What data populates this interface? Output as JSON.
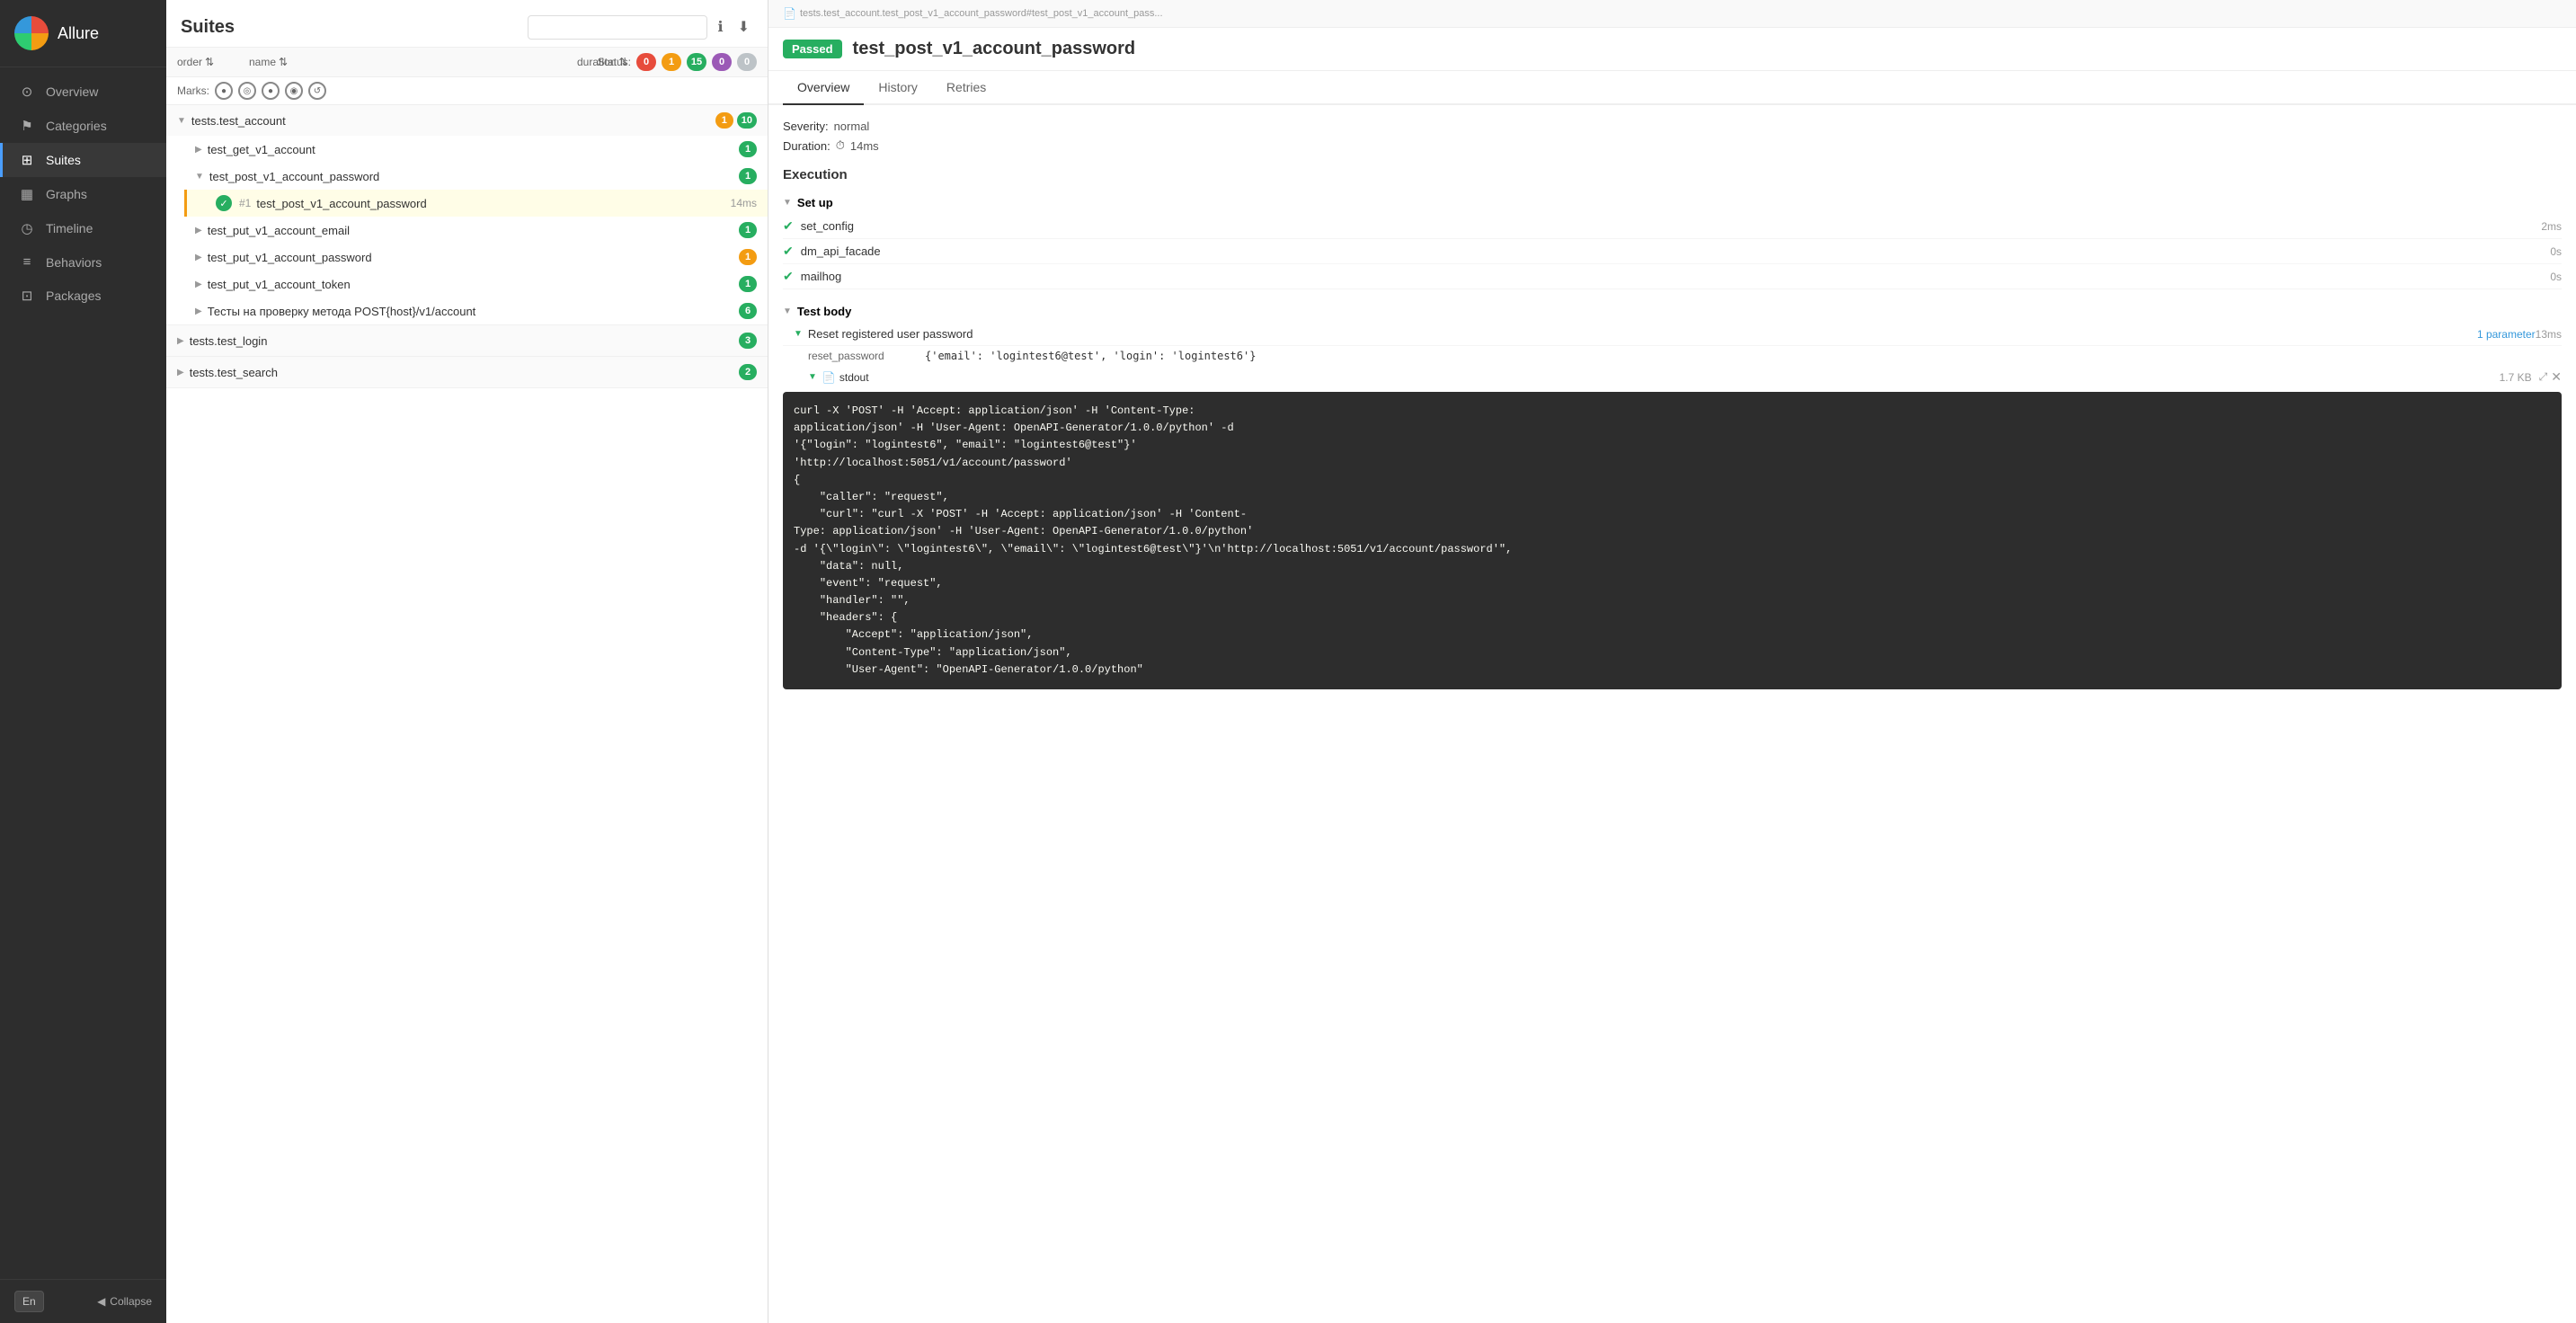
{
  "sidebar": {
    "app_name": "Allure",
    "items": [
      {
        "id": "overview",
        "label": "Overview",
        "icon": "⊙",
        "active": false
      },
      {
        "id": "categories",
        "label": "Categories",
        "icon": "⚑",
        "active": false
      },
      {
        "id": "suites",
        "label": "Suites",
        "icon": "⊞",
        "active": true
      },
      {
        "id": "graphs",
        "label": "Graphs",
        "icon": "▦",
        "active": false
      },
      {
        "id": "timeline",
        "label": "Timeline",
        "icon": "◷",
        "active": false
      },
      {
        "id": "behaviors",
        "label": "Behaviors",
        "icon": "≡",
        "active": false
      },
      {
        "id": "packages",
        "label": "Packages",
        "icon": "⊡",
        "active": false
      }
    ],
    "lang_button": "En",
    "collapse_label": "Collapse"
  },
  "suites_panel": {
    "title": "Suites",
    "search_placeholder": "",
    "columns": {
      "order": "order",
      "name": "name",
      "duration": "duration",
      "status": "status"
    },
    "status_label": "Status:",
    "status_counts": {
      "red": "0",
      "yellow": "1",
      "green": "15",
      "purple": "0",
      "gray": "0"
    },
    "marks_label": "Marks:",
    "groups": [
      {
        "id": "test_account",
        "name": "tests.test_account",
        "badge1": "1",
        "badge2": "10",
        "expanded": true,
        "children": [
          {
            "id": "test_get_v1_account",
            "name": "test_get_v1_account",
            "badge": "1",
            "expanded": false,
            "tests": []
          },
          {
            "id": "test_post_v1_account_password",
            "name": "test_post_v1_account_password",
            "badge": "1",
            "expanded": true,
            "tests": [
              {
                "id": "test1",
                "number": "#1",
                "name": "test_post_v1_account_password",
                "duration": "14ms",
                "status": "passed",
                "selected": true
              }
            ]
          },
          {
            "id": "test_put_v1_account_email",
            "name": "test_put_v1_account_email",
            "badge": "1",
            "expanded": false
          },
          {
            "id": "test_put_v1_account_password",
            "name": "test_put_v1_account_password",
            "badge": "1",
            "expanded": false
          },
          {
            "id": "test_put_v1_account_token",
            "name": "test_put_v1_account_token",
            "badge": "1",
            "expanded": false
          },
          {
            "id": "test_post_host_v1_account",
            "name": "Тесты на проверку метода POST{host}/v1/account",
            "badge": "6",
            "expanded": false
          }
        ]
      },
      {
        "id": "test_login",
        "name": "tests.test_login",
        "badge": "3",
        "expanded": false
      },
      {
        "id": "test_search",
        "name": "tests.test_search",
        "badge": "2",
        "expanded": false
      }
    ]
  },
  "detail_panel": {
    "breadcrumb": "tests.test_account.test_post_v1_account_password#test_post_v1_account_pass...",
    "breadcrumb_icon": "📄",
    "status_badge": "Passed",
    "test_name": "test_post_v1_account_password",
    "tabs": [
      "Overview",
      "History",
      "Retries"
    ],
    "active_tab": "Overview",
    "severity_label": "Severity:",
    "severity_value": "normal",
    "duration_label": "Duration:",
    "duration_value": "14ms",
    "execution_title": "Execution",
    "setup_title": "Set up",
    "setup_items": [
      {
        "name": "set_config",
        "duration": "2ms",
        "status": "passed"
      },
      {
        "name": "dm_api_facade",
        "duration": "0s",
        "status": "passed"
      },
      {
        "name": "mailhog",
        "duration": "0s",
        "status": "passed"
      }
    ],
    "test_body_title": "Test body",
    "steps": [
      {
        "name": "Reset registered user password",
        "param_count": "1 parameter",
        "duration": "13ms",
        "expanded": true,
        "params": [
          {
            "name": "reset_password",
            "value": "{'email': 'logintest6@test', 'login': 'logintest6'}"
          }
        ],
        "attachments": [
          {
            "name": "stdout",
            "size": "1.7 KB",
            "has_content": true
          }
        ]
      }
    ],
    "code_content": "curl -X 'POST' -H 'Accept: application/json' -H 'Content-Type:\napplication/json' -H 'User-Agent: OpenAPI-Generator/1.0.0/python' -d\n'{\"login\": \"logintest6\", \"email\": \"logintest6@test\"}'\n'http://localhost:5051/v1/account/password'\n{\n    \"caller\": \"request\",\n    \"curl\": \"curl -X 'POST' -H 'Accept: application/json' -H 'Content-\nType: application/json' -H 'User-Agent: OpenAPI-Generator/1.0.0/python'\n-d '{\\\"login\\\": \\\"logintest6\\\", \\\"email\\\": \\\"logintest6@test\\\"}'\\n'http://localhost:5051/v1/account/password'\",\n    \"data\": null,\n    \"event\": \"request\",\n    \"handler\": \"\",\n    \"headers\": {\n        \"Accept\": \"application/json\",\n        \"Content-Type\": \"application/json\",\n        \"User-Agent\": \"OpenAPI-Generator/1.0.0/python\""
  }
}
